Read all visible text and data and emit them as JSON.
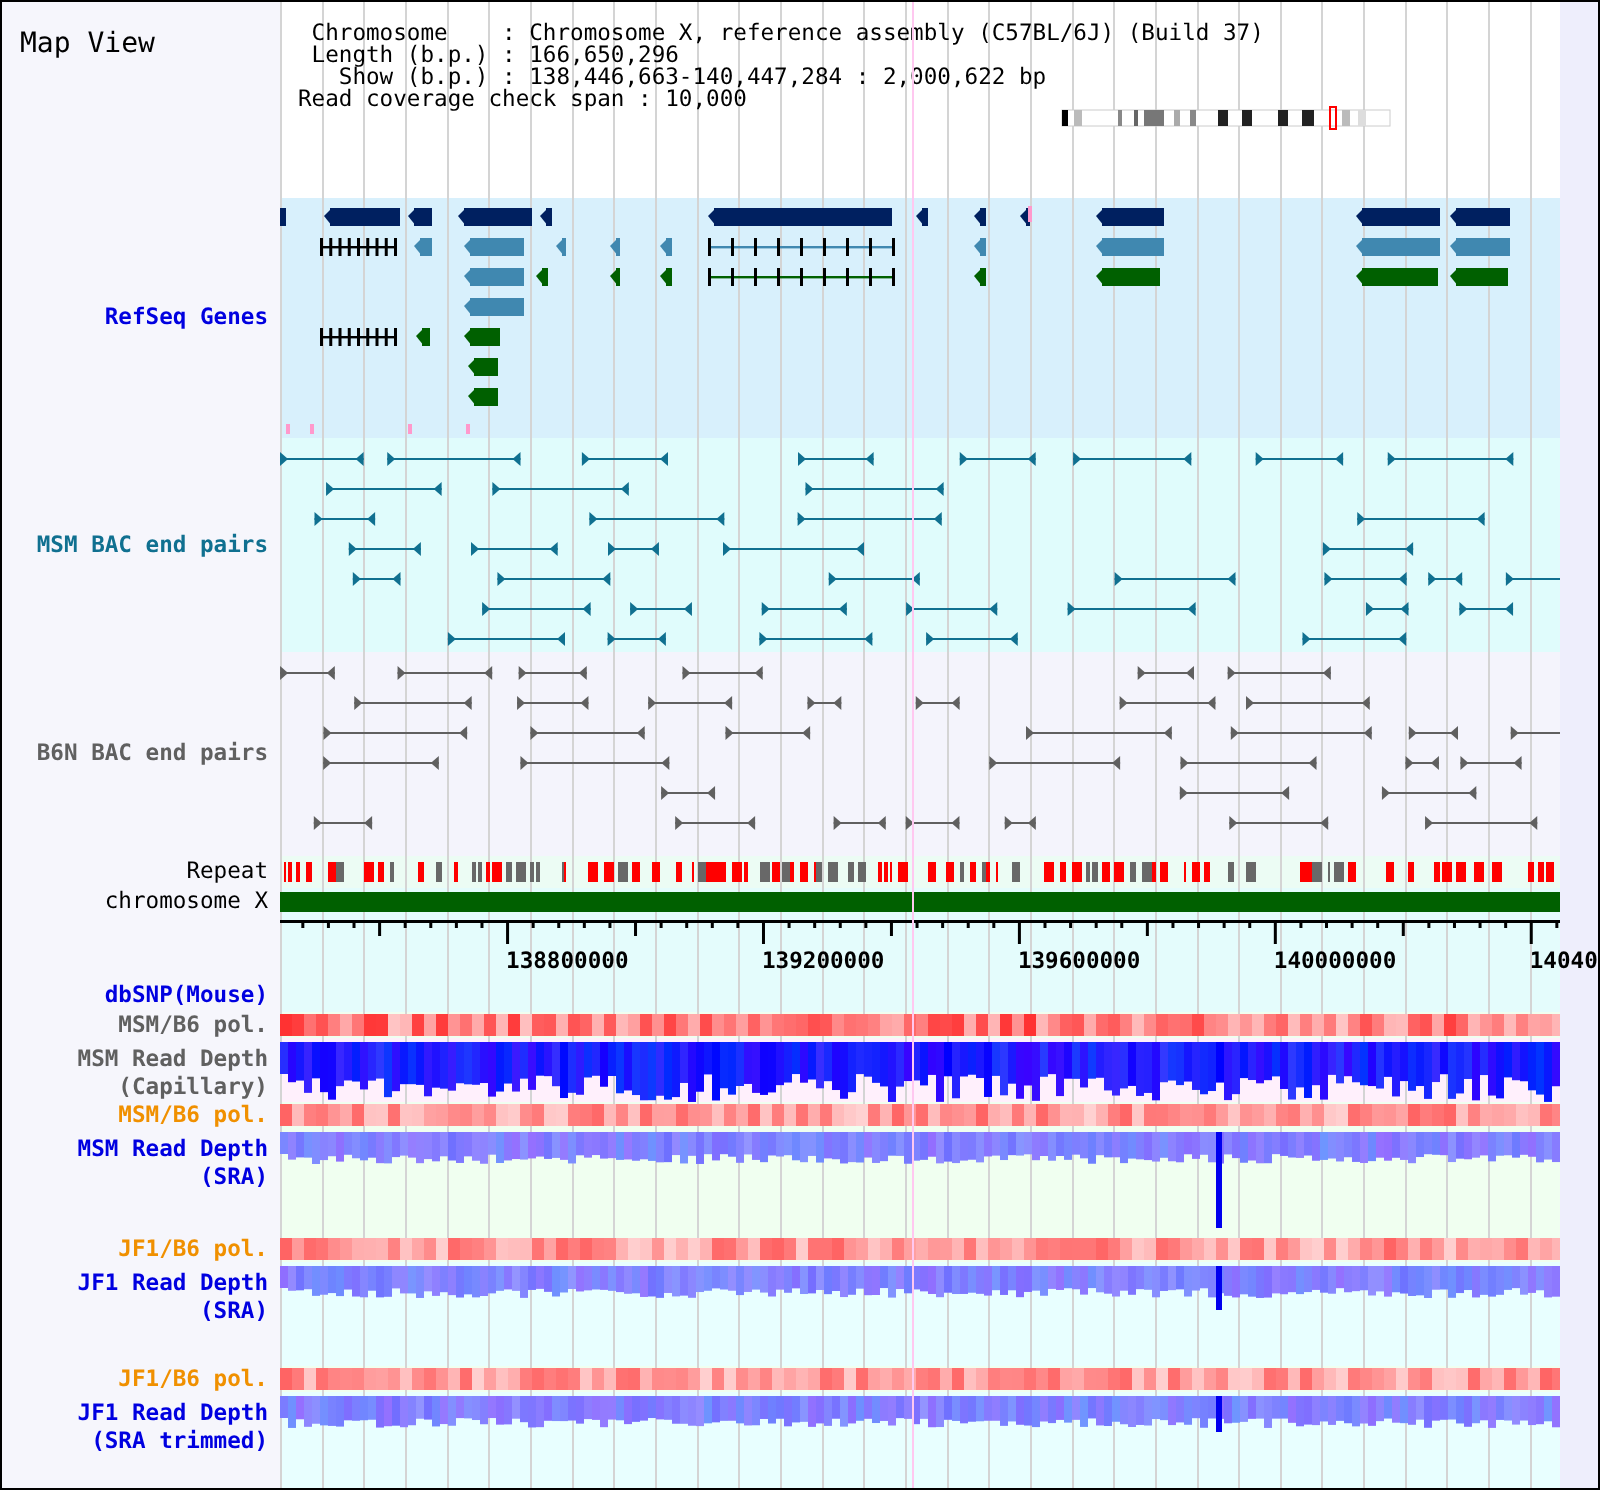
{
  "view_title": "Map View",
  "info_lines": [
    " Chromosome    : Chromosome X, reference assembly (C57BL/6J) (Build 37)",
    " Length (b.p.) : 166,650,296",
    "   Show (b.p.) : 138,446,663-140,447,284 : 2,000,622 bp",
    "Read coverage check span : 10,000"
  ],
  "tracks": [
    {
      "kind": "genes",
      "label_lines": [
        "RefSeq Genes"
      ],
      "color": "#0000e0"
    },
    {
      "kind": "bac_pairs",
      "label_lines": [
        "MSM BAC end pairs"
      ],
      "color": "#107090"
    },
    {
      "kind": "bac_pairs",
      "label_lines": [
        "B6N BAC end pairs"
      ],
      "color": "#606060"
    },
    {
      "kind": "repeat",
      "label_lines": [
        "Repeat"
      ],
      "color": "#000000"
    },
    {
      "kind": "chromosome",
      "label_lines": [
        "chromosome X"
      ],
      "color": "#000000"
    },
    {
      "kind": "axis",
      "ticks": [
        "138800000",
        "139200000",
        "139600000",
        "140000000",
        "14040"
      ]
    },
    {
      "kind": "snp",
      "label_lines": [
        "dbSNP(Mouse)"
      ],
      "color": "#0000e0"
    },
    {
      "kind": "polymorphism",
      "label_lines": [
        "MSM/B6 pol."
      ],
      "color": "#606060"
    },
    {
      "kind": "depth_capillary",
      "label_lines": [
        "MSM Read Depth",
        "(Capillary)"
      ],
      "color": "#606060"
    },
    {
      "kind": "polymorphism",
      "label_lines": [
        "MSM/B6 pol."
      ],
      "color": "#f09000"
    },
    {
      "kind": "depth_sra",
      "label_lines": [
        "MSM Read Depth",
        "(SRA)"
      ],
      "color": "#0000e0"
    },
    {
      "kind": "polymorphism",
      "label_lines": [
        "JF1/B6 pol."
      ],
      "color": "#f09000"
    },
    {
      "kind": "depth_sra",
      "label_lines": [
        "JF1 Read Depth",
        "(SRA)"
      ],
      "color": "#0000e0"
    },
    {
      "kind": "polymorphism",
      "label_lines": [
        "JF1/B6 pol."
      ],
      "color": "#f09000"
    },
    {
      "kind": "depth_sra",
      "label_lines": [
        "JF1 Read Depth",
        "(SRA trimmed)"
      ],
      "color": "#0000e0"
    }
  ]
}
